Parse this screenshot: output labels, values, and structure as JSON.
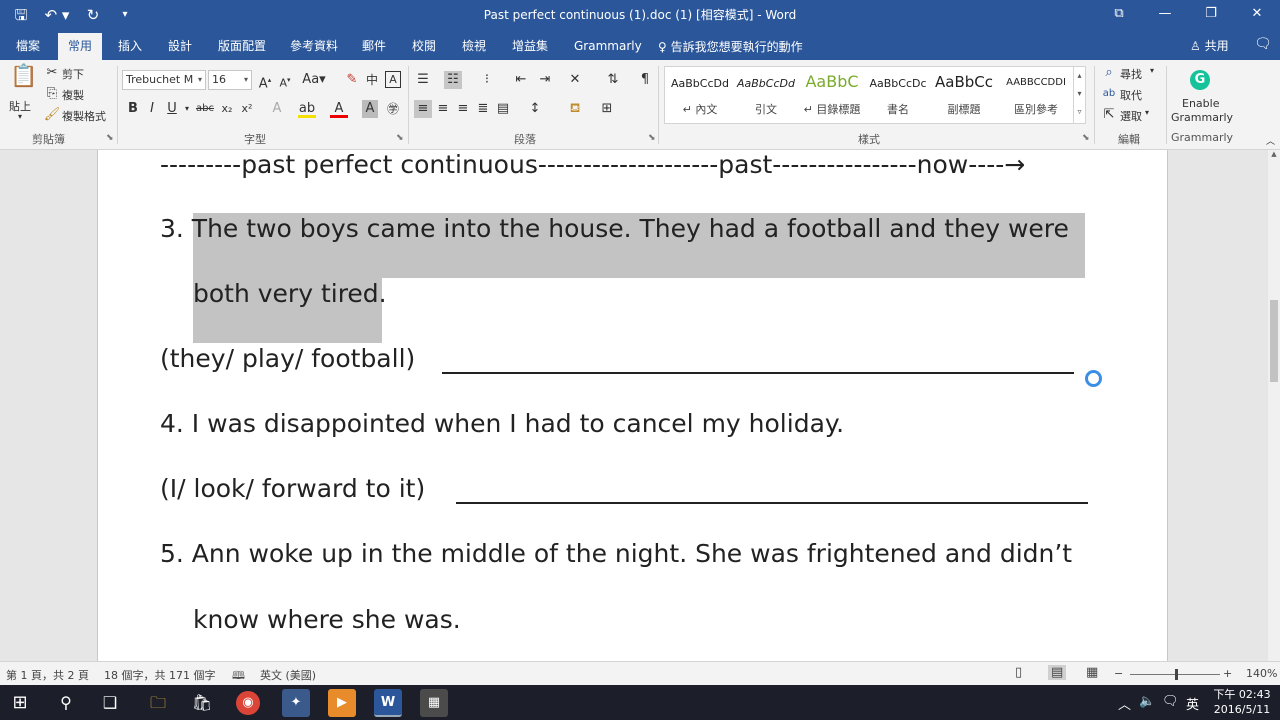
{
  "window": {
    "title": "Past perfect continuous (1).doc (1) [相容模式] - Word",
    "qat": {
      "save": "🖫",
      "undo": "↶ ▾",
      "redo": "↻",
      "customize": "▾"
    },
    "controls": {
      "ribbon_opts": "⧉",
      "minimize": "—",
      "restore": "❐",
      "close": "✕"
    }
  },
  "tabs": [
    "檔案",
    "常用",
    "插入",
    "設計",
    "版面配置",
    "參考資料",
    "郵件",
    "校閱",
    "檢視",
    "增益集",
    "Grammarly"
  ],
  "tell_me": "♀ 告訴我您想要執行的動作",
  "share": "♙ 共用",
  "comment_icon": "🗨",
  "ribbon": {
    "clipboard": {
      "label": "剪貼簿",
      "paste": "貼上",
      "cut": "剪下",
      "copy": "複製",
      "format_painter": "複製格式"
    },
    "font": {
      "label": "字型",
      "font_name": "Trebuchet M",
      "font_size": "16"
    },
    "paragraph": {
      "label": "段落"
    },
    "styles": {
      "label": "樣式",
      "items": [
        {
          "sample": "AaBbCcDd",
          "name": "↵ 內文"
        },
        {
          "sample": "AaBbCcDd",
          "name": "引文"
        },
        {
          "sample": "AaBbC",
          "name": "↵ 目錄標題"
        },
        {
          "sample": "AaBbCcDc",
          "name": "書名"
        },
        {
          "sample": "AaBbCc",
          "name": "副標題"
        },
        {
          "sample": "AABBCCDDI",
          "name": "區別參考"
        }
      ]
    },
    "editing": {
      "label": "編輯",
      "find": "尋找",
      "replace": "取代",
      "select": "選取"
    },
    "grammarly": {
      "label": "Grammarly",
      "enable_line1": "Enable",
      "enable_line2": "Grammarly"
    }
  },
  "document": {
    "lines": [
      "---------past perfect continuous--------------------past----------------now----→",
      "3. The two boys came into the house. They had a football and they were",
      "both very tired.",
      "(they/ play/ football)",
      "4. I was disappointed when I had to cancel my holiday.",
      "(I/ look/ forward to it)",
      "5. Ann woke up in the middle of the night. She was frightened and didn’t",
      "know where she was."
    ]
  },
  "statusbar": {
    "page": "第 1 頁，共 2 頁",
    "words": "18 個字，共 171 個字",
    "proof_icon": "🕮",
    "language": "英文 (美國)",
    "zoom_minus": "−",
    "zoom_plus": "+",
    "zoom": "140%"
  },
  "taskbar": {
    "ime": "英",
    "time": "下午 02:43",
    "date": "2016/5/11"
  },
  "colors": {
    "accent": "#2b579a",
    "highlight": "#c3c3c3",
    "grammarly": "#15c39a"
  }
}
